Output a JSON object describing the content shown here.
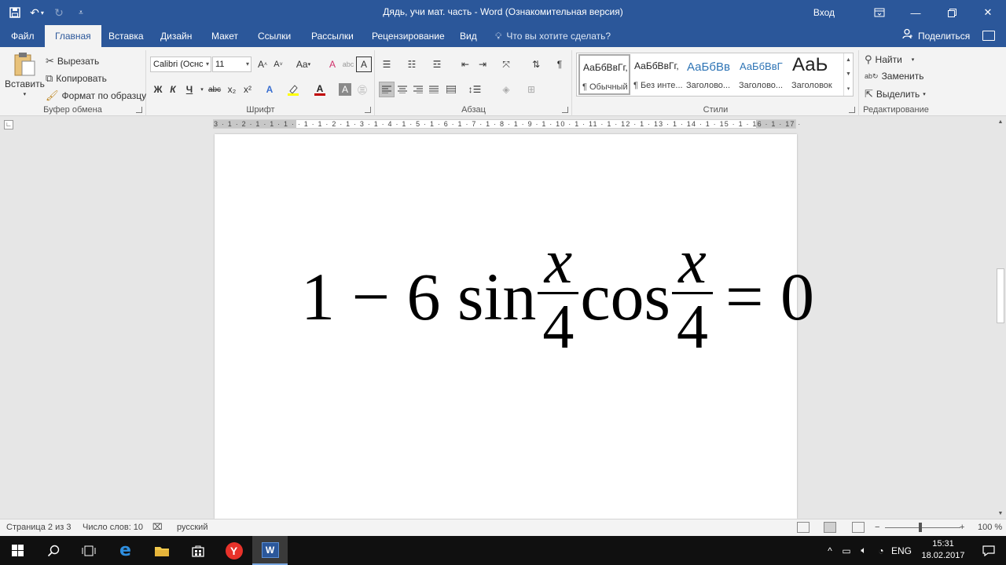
{
  "window": {
    "title": "Дядь, учи мат. часть  -  Word (Ознакомительная версия)",
    "sign_in": "Вход"
  },
  "tabs": [
    {
      "label": "Файл"
    },
    {
      "label": "Главная"
    },
    {
      "label": "Вставка"
    },
    {
      "label": "Дизайн"
    },
    {
      "label": "Макет"
    },
    {
      "label": "Ссылки"
    },
    {
      "label": "Рассылки"
    },
    {
      "label": "Рецензирование"
    },
    {
      "label": "Вид"
    }
  ],
  "tell_me": "Что вы хотите сделать?",
  "share": "Поделиться",
  "clipboard": {
    "paste": "Вставить",
    "cut": "Вырезать",
    "copy": "Копировать",
    "format_painter": "Формат по образцу",
    "label": "Буфер обмена"
  },
  "font": {
    "name": "Calibri (Оснс",
    "size": "11",
    "change_case": "Aa",
    "bold": "Ж",
    "italic": "К",
    "underline": "Ч",
    "strike": "abc",
    "subscript": "x₂",
    "superscript": "x²",
    "label": "Шрифт"
  },
  "paragraph": {
    "label": "Абзац"
  },
  "styles": {
    "items": [
      {
        "sample": "АаБбВвГг,",
        "name": "¶ Обычный"
      },
      {
        "sample": "АаБбВвГг,",
        "name": "¶ Без инте..."
      },
      {
        "sample": "АаБбВв",
        "name": "Заголово..."
      },
      {
        "sample": "АаБбВвГ",
        "name": "Заголово..."
      },
      {
        "sample": "АаЬ",
        "name": "Заголовок"
      }
    ],
    "label": "Стили"
  },
  "editing": {
    "find": "Найти",
    "replace": "Заменить",
    "select": "Выделить",
    "label": "Редактирование"
  },
  "ruler": "3 · 1 · 2 · 1 · 1 · 1 ·  · 1 · 1 · 2 · 1 · 3 · 1 · 4 · 1 · 5 · 1 · 6 · 1 · 7 · 1 · 8 · 1 · 9 · 1 · 10 · 1 · 11 · 1 · 12 · 1 · 13 · 1 · 14 · 1 · 15 · 1 · 16 · 1 · 17 ·",
  "document": {
    "eq_start": "1 − 6 sin",
    "frac1_num": "x",
    "frac1_den": "4",
    "eq_mid": "cos",
    "frac2_num": "x",
    "frac2_den": "4",
    "eq_end": "= 0"
  },
  "status": {
    "page": "Страница 2 из 3",
    "words": "Число слов: 10",
    "language": "русский",
    "zoom": "100 %"
  },
  "taskbar": {
    "lang": "ENG",
    "time": "15:31",
    "date": "18.02.2017"
  },
  "colors": {
    "accent": "#2b579a",
    "highlight": "#ffff00",
    "font_color": "#c00000"
  }
}
